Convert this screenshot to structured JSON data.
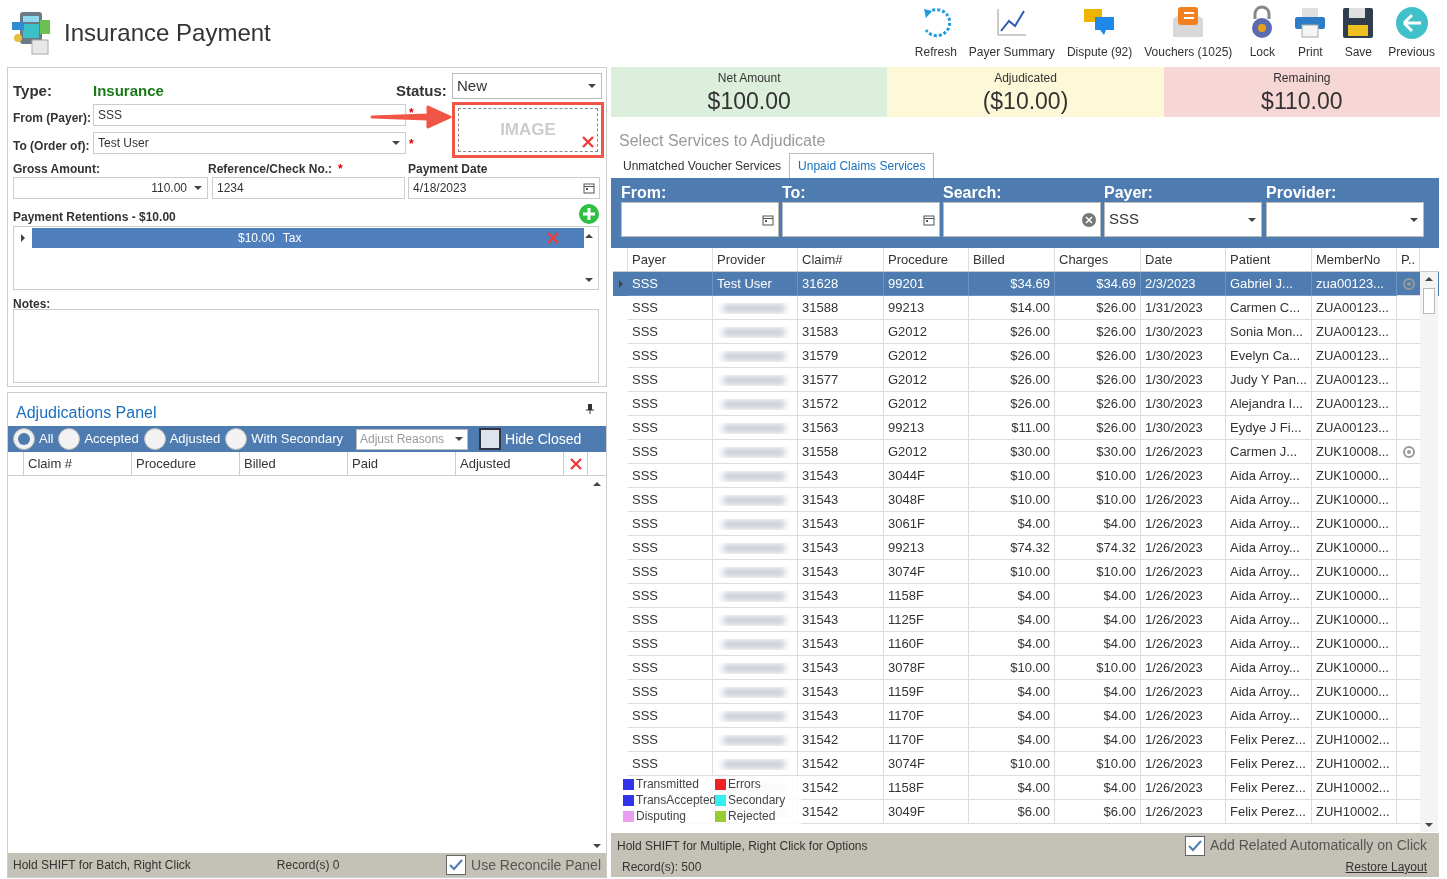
{
  "window": {
    "title": "Insurance Payment"
  },
  "toolbar": [
    {
      "kind": "refresh",
      "label": "Refresh"
    },
    {
      "kind": "chart",
      "label": "Payer Summary"
    },
    {
      "kind": "dispute",
      "label": "Dispute (92)"
    },
    {
      "kind": "vouchers",
      "label": "Vouchers (1025)"
    },
    {
      "kind": "lock",
      "label": "Lock"
    },
    {
      "kind": "print",
      "label": "Print"
    },
    {
      "kind": "save",
      "label": "Save"
    },
    {
      "kind": "previous",
      "label": "Previous"
    }
  ],
  "form": {
    "type_label": "Type:",
    "type_value": "Insurance",
    "status_label": "Status:",
    "status_value": "New",
    "from_label": "From (Payer):",
    "from_value": "SSS",
    "to_label": "To (Order of):",
    "to_value": "Test User",
    "required_mark": "*",
    "image_label": "IMAGE",
    "gross_label": "Gross Amount:",
    "gross_value": "110.00",
    "ref_label": "Reference/Check No.:",
    "ref_value": "1234",
    "date_label": "Payment Date",
    "date_value": "4/18/2023",
    "retentions_label": "Payment Retentions - $10.00",
    "retentions": [
      {
        "amount": "$10.00",
        "name": "Tax",
        "selected": true
      }
    ],
    "notes_label": "Notes:"
  },
  "adjudications": {
    "title": "Adjudications Panel",
    "filters": [
      {
        "label": "All",
        "selected": true
      },
      {
        "label": "Accepted",
        "selected": false
      },
      {
        "label": "Adjusted",
        "selected": false
      },
      {
        "label": "With Secondary",
        "selected": false
      }
    ],
    "reasons_placeholder": "Adjust Reasons",
    "hide_closed": {
      "label": "Hide Closed",
      "checked": false
    },
    "columns": [
      "Claim #",
      "Procedure",
      "Billed",
      "Paid",
      "Adjusted"
    ],
    "status_hint": "Hold SHIFT for Batch, Right Click",
    "records": "Record(s) 0",
    "use_reconcile": {
      "label": "Use Reconcile Panel",
      "checked": true
    }
  },
  "summary": [
    {
      "label": "Net Amount",
      "value": "$100.00",
      "color": "#dcefdc"
    },
    {
      "label": "Adjudicated",
      "value": "($10.00)",
      "color": "#fdf9d8"
    },
    {
      "label": "Remaining",
      "value": "$110.00",
      "color": "#f7d6d6"
    }
  ],
  "services": {
    "title": "Select Services to Adjudicate",
    "tabs": [
      {
        "label": "Unmatched Voucher Services",
        "selected": false
      },
      {
        "label": "Unpaid Claims Services",
        "selected": true
      }
    ],
    "filters": {
      "from_label": "From:",
      "to_label": "To:",
      "search_label": "Search:",
      "payer_label": "Payer:",
      "payer_value": "SSS",
      "provider_label": "Provider:"
    },
    "columns": [
      "Payer",
      "Provider",
      "Claim#",
      "Procedure",
      "Billed",
      "Charges",
      "Date",
      "Patient",
      "MemberNo",
      "P.."
    ],
    "rows": [
      {
        "payer": "SSS",
        "provider": "Test User",
        "claim": "31628",
        "procedure": "99201",
        "billed": "$34.69",
        "charges": "$34.69",
        "date": "2/3/2023",
        "patient": "Gabriel J...",
        "member": "zua00123...",
        "flag": true,
        "selected": true
      },
      {
        "payer": "SSS",
        "claim": "31588",
        "procedure": "99213",
        "billed": "$14.00",
        "charges": "$26.00",
        "date": "1/31/2023",
        "patient": "Carmen C...",
        "member": "ZUA00123...",
        "flag": false,
        "selected": false
      },
      {
        "payer": "SSS",
        "claim": "31583",
        "procedure": "G2012",
        "billed": "$26.00",
        "charges": "$26.00",
        "date": "1/30/2023",
        "patient": "Sonia Mon...",
        "member": "ZUA00123...",
        "flag": false,
        "selected": false
      },
      {
        "payer": "SSS",
        "claim": "31579",
        "procedure": "G2012",
        "billed": "$26.00",
        "charges": "$26.00",
        "date": "1/30/2023",
        "patient": "Evelyn Ca...",
        "member": "ZUA00123...",
        "flag": false,
        "selected": false
      },
      {
        "payer": "SSS",
        "claim": "31577",
        "procedure": "G2012",
        "billed": "$26.00",
        "charges": "$26.00",
        "date": "1/30/2023",
        "patient": "Judy Y Pan...",
        "member": "ZUA00123...",
        "flag": false,
        "selected": false
      },
      {
        "payer": "SSS",
        "claim": "31572",
        "procedure": "G2012",
        "billed": "$26.00",
        "charges": "$26.00",
        "date": "1/30/2023",
        "patient": "Alejandra I...",
        "member": "ZUA00123...",
        "flag": false,
        "selected": false
      },
      {
        "payer": "SSS",
        "claim": "31563",
        "procedure": "99213",
        "billed": "$11.00",
        "charges": "$26.00",
        "date": "1/30/2023",
        "patient": "Eydye J Fi...",
        "member": "ZUA00123...",
        "flag": false,
        "selected": false
      },
      {
        "payer": "SSS",
        "claim": "31558",
        "procedure": "G2012",
        "billed": "$30.00",
        "charges": "$30.00",
        "date": "1/26/2023",
        "patient": "Carmen J...",
        "member": "ZUK10008...",
        "flag": true,
        "selected": false
      },
      {
        "payer": "SSS",
        "claim": "31543",
        "procedure": "3044F",
        "billed": "$10.00",
        "charges": "$10.00",
        "date": "1/26/2023",
        "patient": "Aida Arroy...",
        "member": "ZUK10000...",
        "flag": false,
        "selected": false
      },
      {
        "payer": "SSS",
        "claim": "31543",
        "procedure": "3048F",
        "billed": "$10.00",
        "charges": "$10.00",
        "date": "1/26/2023",
        "patient": "Aida Arroy...",
        "member": "ZUK10000...",
        "flag": false,
        "selected": false
      },
      {
        "payer": "SSS",
        "claim": "31543",
        "procedure": "3061F",
        "billed": "$4.00",
        "charges": "$4.00",
        "date": "1/26/2023",
        "patient": "Aida Arroy...",
        "member": "ZUK10000...",
        "flag": false,
        "selected": false
      },
      {
        "payer": "SSS",
        "claim": "31543",
        "procedure": "99213",
        "billed": "$74.32",
        "charges": "$74.32",
        "date": "1/26/2023",
        "patient": "Aida Arroy...",
        "member": "ZUK10000...",
        "flag": false,
        "selected": false
      },
      {
        "payer": "SSS",
        "claim": "31543",
        "procedure": "3074F",
        "billed": "$10.00",
        "charges": "$10.00",
        "date": "1/26/2023",
        "patient": "Aida Arroy...",
        "member": "ZUK10000...",
        "flag": false,
        "selected": false
      },
      {
        "payer": "SSS",
        "claim": "31543",
        "procedure": "1158F",
        "billed": "$4.00",
        "charges": "$4.00",
        "date": "1/26/2023",
        "patient": "Aida Arroy...",
        "member": "ZUK10000...",
        "flag": false,
        "selected": false
      },
      {
        "payer": "SSS",
        "claim": "31543",
        "procedure": "1125F",
        "billed": "$4.00",
        "charges": "$4.00",
        "date": "1/26/2023",
        "patient": "Aida Arroy...",
        "member": "ZUK10000...",
        "flag": false,
        "selected": false
      },
      {
        "payer": "SSS",
        "claim": "31543",
        "procedure": "1160F",
        "billed": "$4.00",
        "charges": "$4.00",
        "date": "1/26/2023",
        "patient": "Aida Arroy...",
        "member": "ZUK10000...",
        "flag": false,
        "selected": false
      },
      {
        "payer": "SSS",
        "claim": "31543",
        "procedure": "3078F",
        "billed": "$10.00",
        "charges": "$10.00",
        "date": "1/26/2023",
        "patient": "Aida Arroy...",
        "member": "ZUK10000...",
        "flag": false,
        "selected": false
      },
      {
        "payer": "SSS",
        "claim": "31543",
        "procedure": "1159F",
        "billed": "$4.00",
        "charges": "$4.00",
        "date": "1/26/2023",
        "patient": "Aida Arroy...",
        "member": "ZUK10000...",
        "flag": false,
        "selected": false
      },
      {
        "payer": "SSS",
        "claim": "31543",
        "procedure": "1170F",
        "billed": "$4.00",
        "charges": "$4.00",
        "date": "1/26/2023",
        "patient": "Aida Arroy...",
        "member": "ZUK10000...",
        "flag": false,
        "selected": false
      },
      {
        "payer": "SSS",
        "claim": "31542",
        "procedure": "1170F",
        "billed": "$4.00",
        "charges": "$4.00",
        "date": "1/26/2023",
        "patient": "Felix Perez...",
        "member": "ZUH10002...",
        "flag": false,
        "selected": false
      },
      {
        "payer": "SSS",
        "claim": "31542",
        "procedure": "3074F",
        "billed": "$10.00",
        "charges": "$10.00",
        "date": "1/26/2023",
        "patient": "Felix Perez...",
        "member": "ZUH10002...",
        "flag": false,
        "selected": false
      },
      {
        "claim": "31542",
        "procedure": "1158F",
        "billed": "$4.00",
        "charges": "$4.00",
        "date": "1/26/2023",
        "patient": "Felix Perez...",
        "member": "ZUH10002...",
        "flag": false,
        "selected": false
      },
      {
        "claim": "31542",
        "procedure": "3049F",
        "billed": "$6.00",
        "charges": "$6.00",
        "date": "1/26/2023",
        "patient": "Felix Perez...",
        "member": "ZUH10002...",
        "flag": false,
        "selected": false
      }
    ],
    "legend": [
      {
        "label": "Transmitted",
        "color": "#3333ee"
      },
      {
        "label": "Errors",
        "color": "#ee2222"
      },
      {
        "label": "TransAccepted",
        "color": "#3333ee"
      },
      {
        "label": "Secondary",
        "color": "#33eeee"
      },
      {
        "label": "Disputing",
        "color": "#e8a0ee"
      },
      {
        "label": "Rejected",
        "color": "#99cc33"
      }
    ],
    "status_hint": "Hold SHIFT for Multiple, Right Click for Options",
    "records": "Record(s): 500",
    "add_related": {
      "label": "Add Related Automatically on Click",
      "checked": true
    },
    "restore_layout": "Restore Layout"
  }
}
